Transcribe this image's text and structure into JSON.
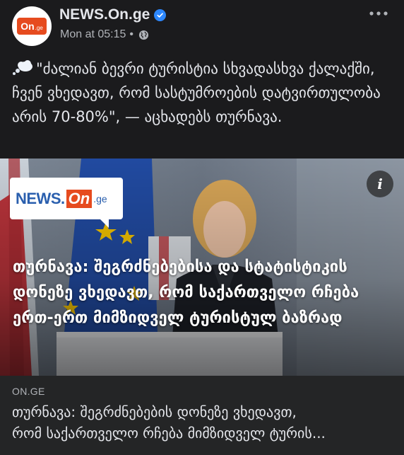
{
  "post": {
    "page_name": "NEWS.On.ge",
    "avatar_logo": "On",
    "avatar_logo_suffix": ".ge",
    "timestamp": "Mon at 05:15",
    "separator": "•",
    "audience_icon": "globe-icon",
    "more_icon": "more-horizontal-icon",
    "text": "\"ძალიან ბევრი ტურისტია სხვადასხვა ქალაქში, ჩვენ ვხედავთ, რომ სასტუმროების დატვირთულობა არის 70-80%\", — აცხადებს თურნავა."
  },
  "media": {
    "brand_part1": "NEWS.",
    "brand_part2": "On",
    "brand_part3": ".ge",
    "info_label": "i",
    "headline": "თურნავა: შეგრძნებებისა და სტატისტიკის დონეზე ვხედავთ, რომ საქართველო რჩება ერთ-ერთ მიმზიდველ ტურისტულ ბაზრად"
  },
  "link": {
    "domain": "ON.GE",
    "title_line1": "თურნავა: შეგრძნებების დონეზე ვხედავთ,",
    "title_line2": "რომ საქართველო რჩება მიმზიდველ ტურის..."
  },
  "colors": {
    "background": "#1b1b1d",
    "link_preview_bg": "#242526",
    "verified_blue": "#2d88ff",
    "brand_orange": "#e64b1f",
    "brand_blue": "#2a5fae"
  }
}
